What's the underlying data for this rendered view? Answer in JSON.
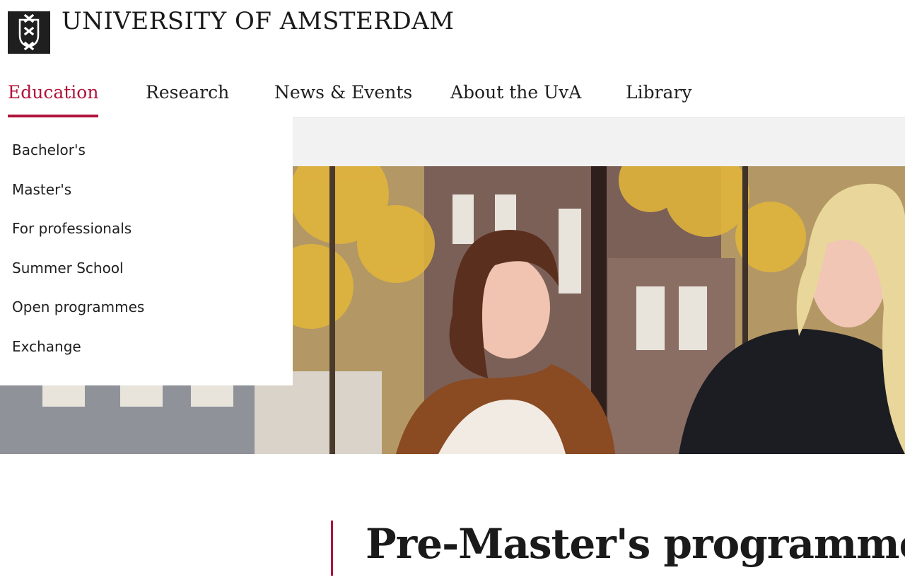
{
  "header": {
    "logo_alt": "university-shield",
    "wordmark": "UNIVERSITY OF AMSTERDAM"
  },
  "nav": {
    "items": [
      {
        "label": "Education",
        "active": true
      },
      {
        "label": "Research",
        "active": false
      },
      {
        "label": "News & Events",
        "active": false
      },
      {
        "label": "About the UvA",
        "active": false
      },
      {
        "label": "Library",
        "active": false
      }
    ]
  },
  "dropdown": {
    "items": [
      {
        "label": "Bachelor's"
      },
      {
        "label": "Master's"
      },
      {
        "label": "For professionals"
      },
      {
        "label": "Summer School"
      },
      {
        "label": "Open programmes"
      },
      {
        "label": "Exchange"
      }
    ]
  },
  "main": {
    "title": "Pre-Master's programmes"
  },
  "colors": {
    "accent": "#b0143a",
    "band": "#f3f2f2",
    "logo_bg": "#1f1f1f"
  }
}
